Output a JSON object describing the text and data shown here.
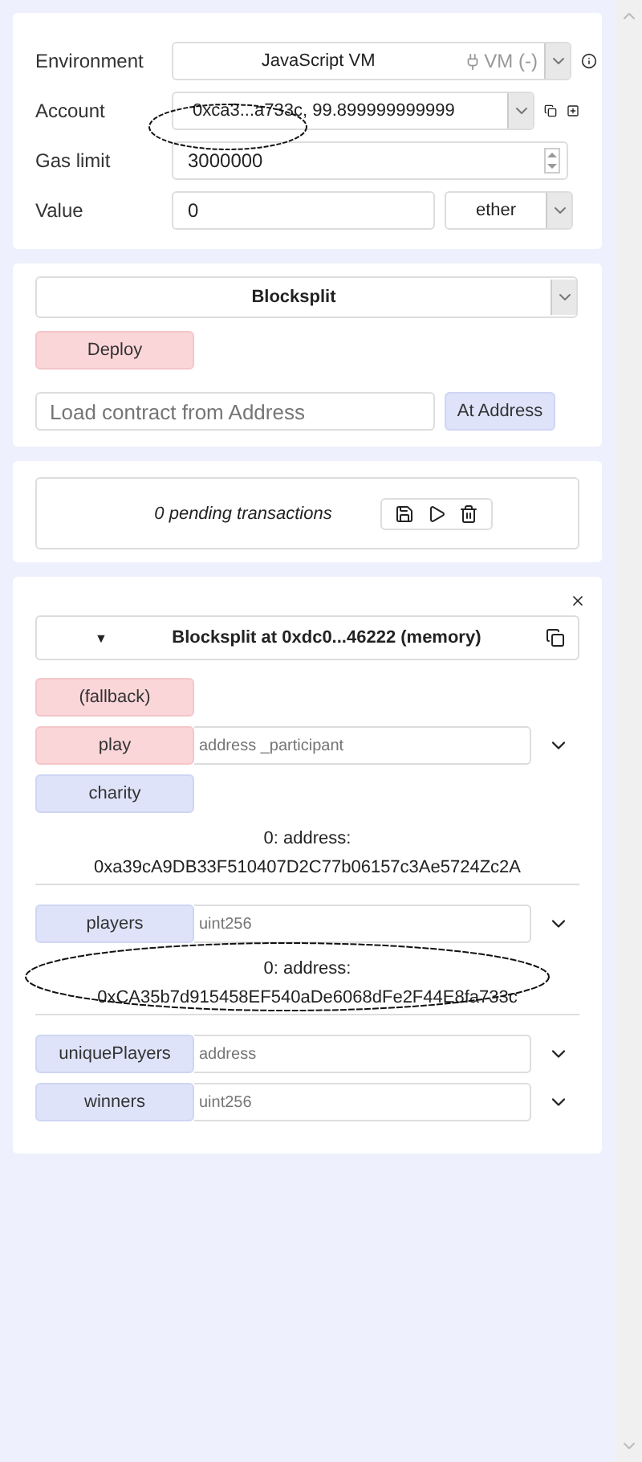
{
  "environment": {
    "label": "Environment",
    "value": "JavaScript VM",
    "provider": "VM (-)"
  },
  "account": {
    "label": "Account",
    "value": "0xca3...a733c, 99.899999999999"
  },
  "gas_limit": {
    "label": "Gas limit",
    "value": "3000000"
  },
  "value": {
    "label": "Value",
    "value": "0",
    "unit": "ether"
  },
  "contract": {
    "selected": "Blocksplit",
    "deploy": "Deploy",
    "address_placeholder": "Load contract from Address",
    "at_address": "At Address"
  },
  "pending": {
    "text": "0 pending transactions"
  },
  "instance": {
    "caret": "▼",
    "title": "Blocksplit at 0xdc0...46222 (memory)",
    "functions": [
      {
        "kind": "transact",
        "name": "(fallback)"
      },
      {
        "kind": "transact",
        "name": "play",
        "placeholder": "address _participant"
      },
      {
        "kind": "call",
        "name": "charity",
        "output": [
          "0: address:",
          "0xa39cA9DB33F510407D2C77b06157c3Ae5724Zc2A"
        ]
      },
      {
        "kind": "call",
        "name": "players",
        "placeholder": "uint256",
        "output": [
          "0: address:",
          "0xCA35b7d915458EF540aDe6068dFe2F44E8fa733c"
        ]
      },
      {
        "kind": "call",
        "name": "uniquePlayers",
        "placeholder": "address"
      },
      {
        "kind": "call",
        "name": "winners",
        "placeholder": "uint256"
      }
    ]
  }
}
